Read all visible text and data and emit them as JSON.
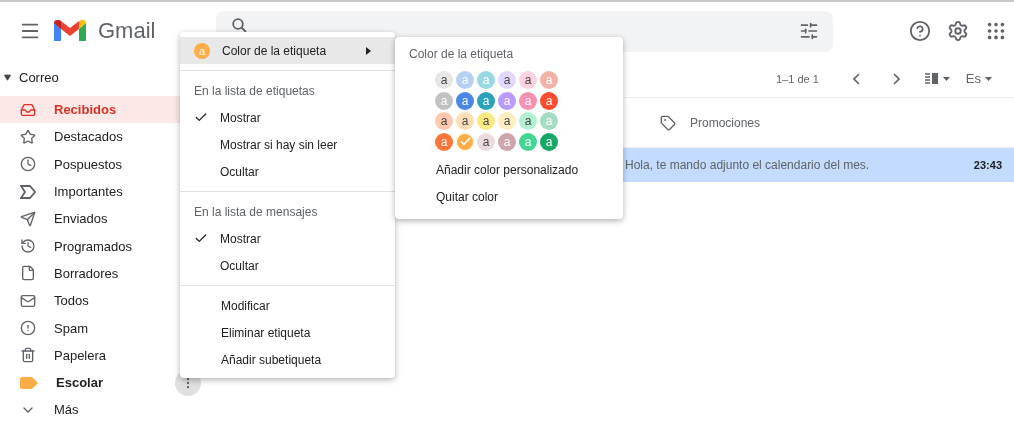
{
  "header": {
    "app_name": "Gmail"
  },
  "sidebar": {
    "section": "Correo",
    "expanded": true,
    "items": [
      {
        "label": "Recibidos",
        "kind": "folder",
        "selected": true
      },
      {
        "label": "Destacados",
        "kind": "folder",
        "selected": false
      },
      {
        "label": "Pospuestos",
        "kind": "folder",
        "selected": false
      },
      {
        "label": "Importantes",
        "kind": "folder",
        "selected": false
      },
      {
        "label": "Enviados",
        "kind": "folder",
        "selected": false
      },
      {
        "label": "Programados",
        "kind": "folder",
        "selected": false
      },
      {
        "label": "Borradores",
        "kind": "folder",
        "selected": false
      },
      {
        "label": "Todos",
        "kind": "folder",
        "selected": false
      },
      {
        "label": "Spam",
        "kind": "folder",
        "selected": false
      },
      {
        "label": "Papelera",
        "kind": "folder",
        "selected": false
      },
      {
        "label": "Escolar",
        "kind": "label",
        "color": "#ffad46",
        "selected": false
      },
      {
        "label": "Más",
        "kind": "more",
        "selected": false
      }
    ]
  },
  "toolbar": {
    "count": "1–1 de 1",
    "input_tool": "Es"
  },
  "tabs": [
    {
      "label": "Promociones",
      "selected": false
    }
  ],
  "messages": [
    {
      "snippet": "Hola, te mando adjunto el calendario del mes.",
      "time": "23:43",
      "selected": true,
      "unread": true
    }
  ],
  "label_menu": {
    "color_item": {
      "label": "Color de la etiqueta",
      "badge": "a",
      "color": "#ffad46",
      "highlighted": true
    },
    "sections": [
      {
        "heading": "En la lista de etiquetas",
        "options": [
          {
            "label": "Mostrar",
            "checked": true
          },
          {
            "label": "Mostrar si hay sin leer",
            "checked": false
          },
          {
            "label": "Ocultar",
            "checked": false
          }
        ]
      },
      {
        "heading": "En la lista de mensajes",
        "options": [
          {
            "label": "Mostrar",
            "checked": true
          },
          {
            "label": "Ocultar",
            "checked": false
          }
        ]
      }
    ],
    "actions": [
      "Modificar",
      "Eliminar etiqueta",
      "Añadir subetiqueta"
    ]
  },
  "color_submenu": {
    "title": "Color de la etiqueta",
    "swatches": [
      [
        {
          "label": "a",
          "color": "#e7e7e7",
          "selected": false
        },
        {
          "label": "a",
          "color": "#b6cff5",
          "selected": false
        },
        {
          "label": "a",
          "color": "#98d7e4",
          "selected": false
        },
        {
          "label": "a",
          "color": "#e3d7ff",
          "selected": false
        },
        {
          "label": "a",
          "color": "#fbd3e0",
          "selected": false
        },
        {
          "label": "a",
          "color": "#f2b2a8",
          "selected": false
        }
      ],
      [
        {
          "label": "a",
          "color": "#c2c2c2",
          "selected": false
        },
        {
          "label": "a",
          "color": "#4986e7",
          "selected": false
        },
        {
          "label": "a",
          "color": "#2da2bb",
          "selected": false
        },
        {
          "label": "a",
          "color": "#b99aff",
          "selected": false
        },
        {
          "label": "a",
          "color": "#f691b2",
          "selected": false
        },
        {
          "label": "a",
          "color": "#fb4c2f",
          "selected": false
        }
      ],
      [
        {
          "label": "a",
          "color": "#ffc8af",
          "selected": false
        },
        {
          "label": "a",
          "color": "#ffdeb5",
          "selected": false
        },
        {
          "label": "a",
          "color": "#fbe983",
          "selected": false
        },
        {
          "label": "a",
          "color": "#fdedc1",
          "selected": false
        },
        {
          "label": "a",
          "color": "#b3efd3",
          "selected": false
        },
        {
          "label": "a",
          "color": "#a2dcc1",
          "selected": false
        }
      ],
      [
        {
          "label": "a",
          "color": "#ff7537",
          "selected": false
        },
        {
          "color": "#ffad46",
          "selected": true
        },
        {
          "label": "a",
          "color": "#ebdbde",
          "selected": false
        },
        {
          "label": "a",
          "color": "#cca6ac",
          "selected": false
        },
        {
          "label": "a",
          "color": "#42d692",
          "selected": false
        },
        {
          "label": "a",
          "color": "#16a765",
          "selected": false
        }
      ]
    ],
    "actions": [
      "Añadir color personalizado",
      "Quitar color"
    ]
  }
}
